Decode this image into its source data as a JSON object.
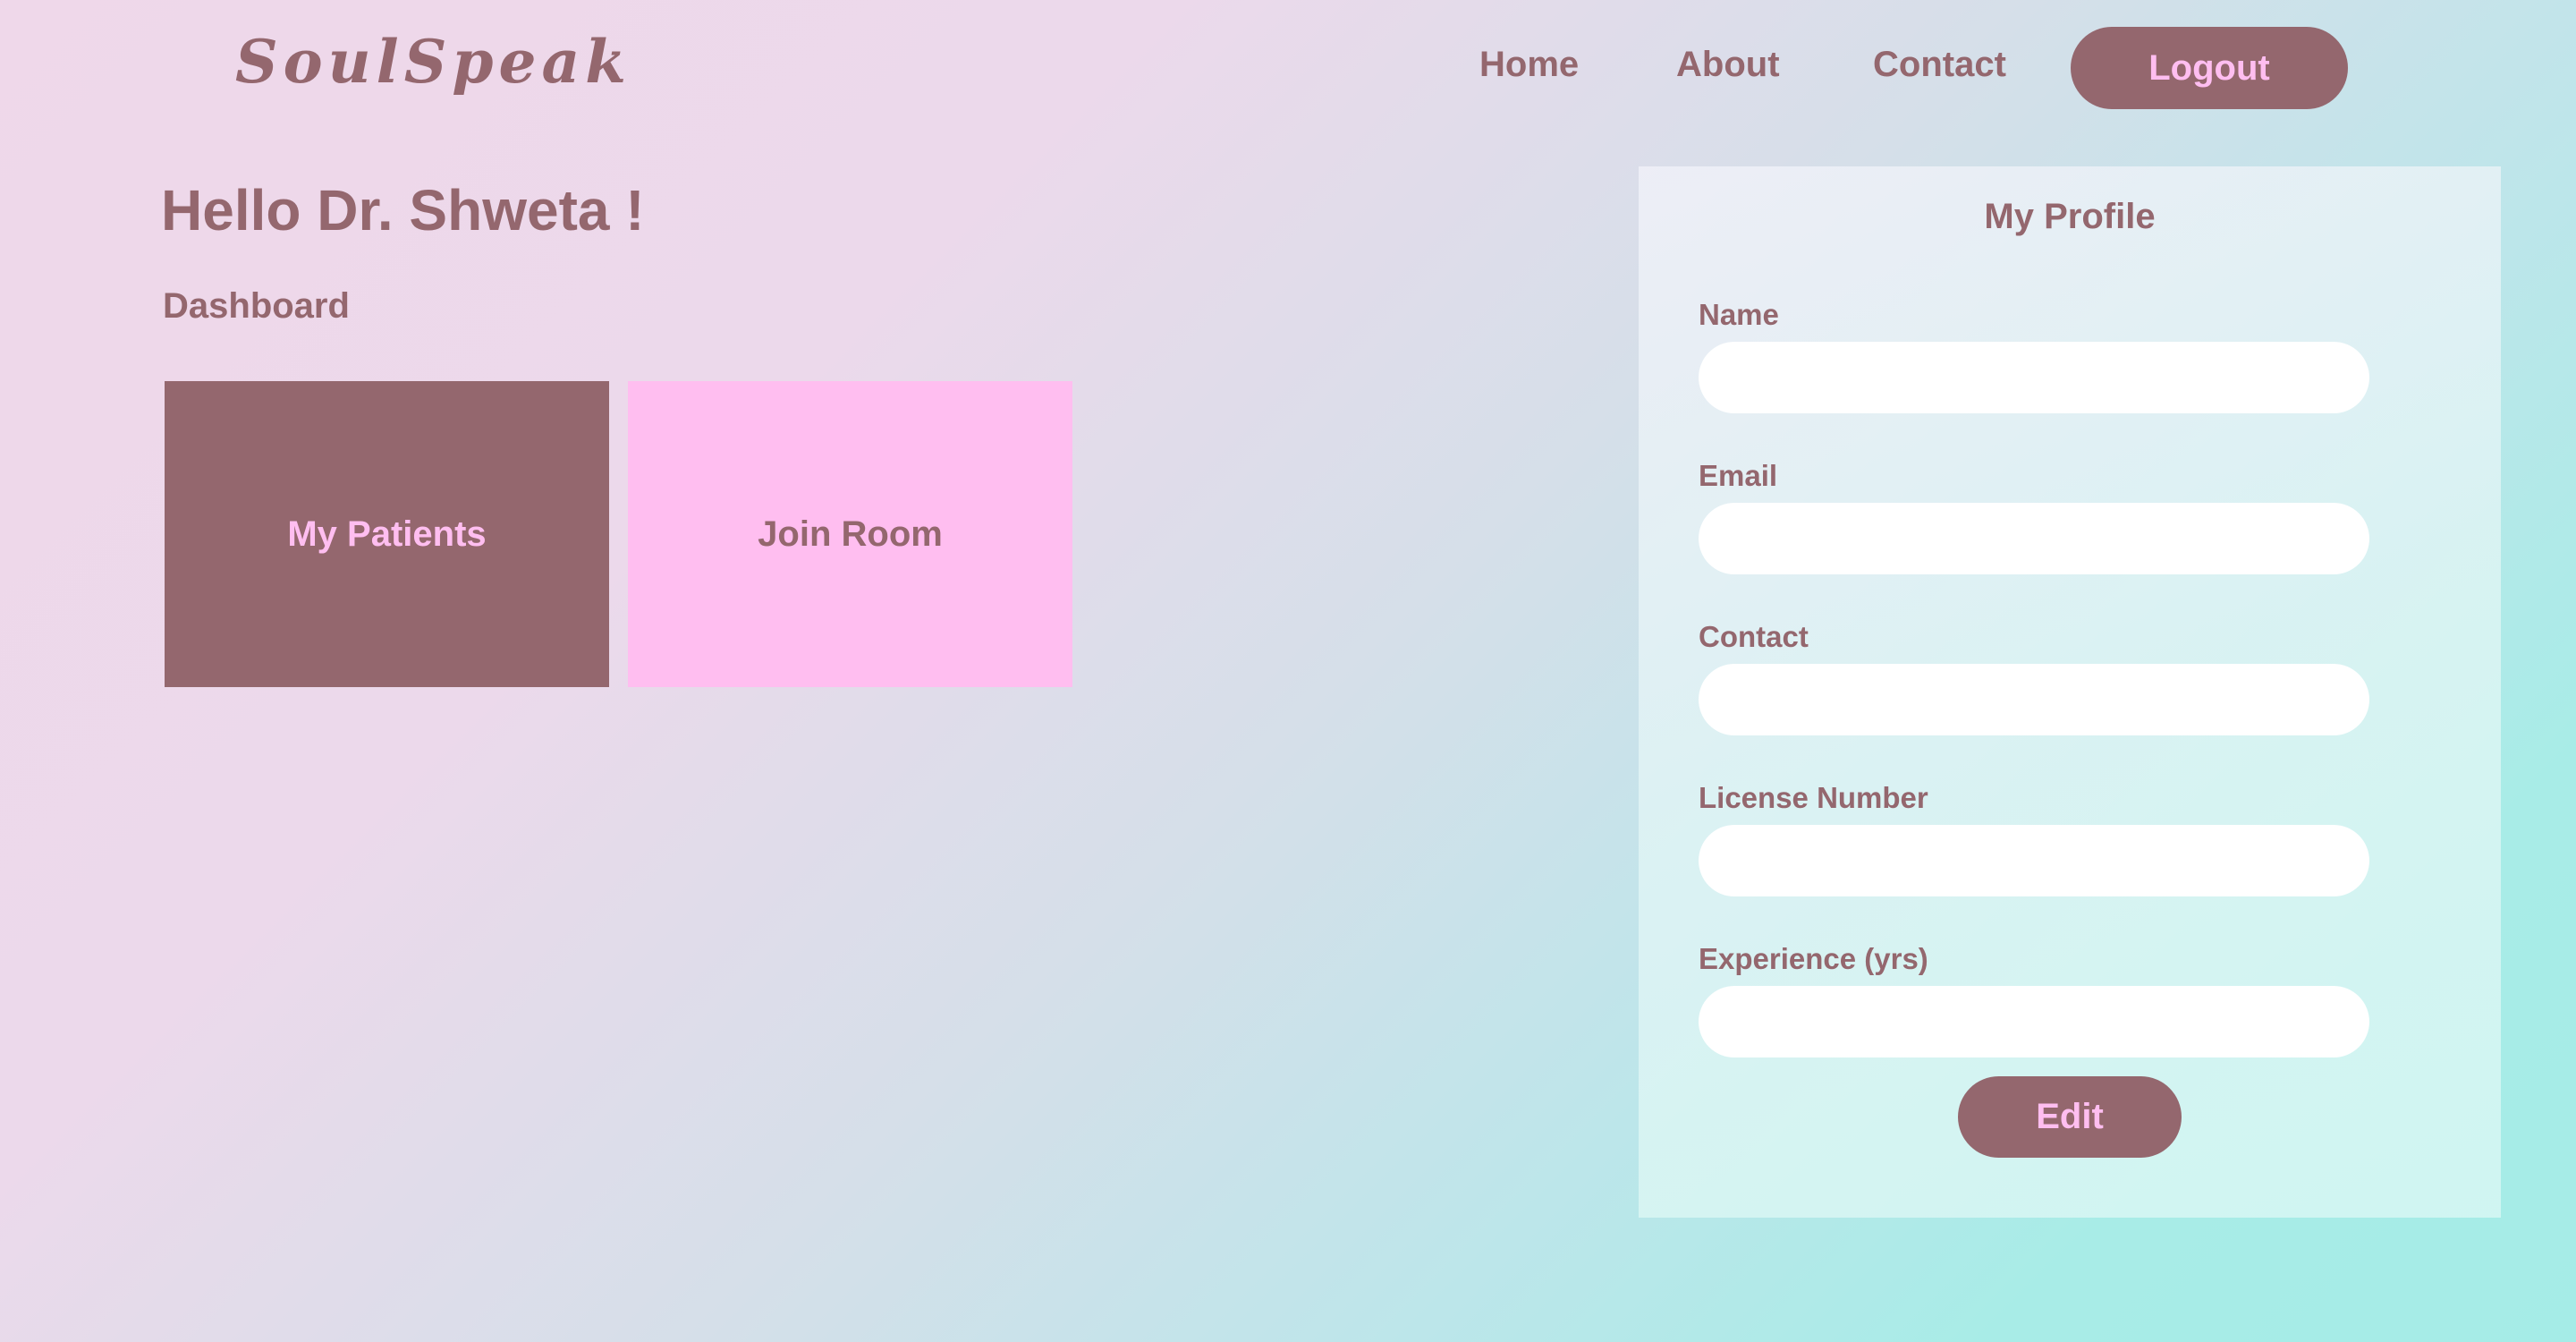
{
  "brand": {
    "name": "SoulSpeak"
  },
  "nav": {
    "links": [
      {
        "label": "Home"
      },
      {
        "label": "About"
      },
      {
        "label": "Contact"
      }
    ],
    "logout_label": "Logout"
  },
  "main": {
    "greeting": "Hello Dr. Shweta !",
    "section_title": "Dashboard",
    "tiles": [
      {
        "label": "My Patients"
      },
      {
        "label": "Join Room"
      }
    ]
  },
  "profile": {
    "title": "My Profile",
    "fields": [
      {
        "label": "Name",
        "value": "",
        "placeholder": ""
      },
      {
        "label": "Email",
        "value": "",
        "placeholder": ""
      },
      {
        "label": "Contact",
        "value": "",
        "placeholder": ""
      },
      {
        "label": "License Number",
        "value": "",
        "placeholder": ""
      },
      {
        "label": "Experience (yrs)",
        "value": "",
        "placeholder": ""
      }
    ],
    "edit_label": "Edit"
  },
  "colors": {
    "primary": "#94676e",
    "accent_pink": "#ffbef0",
    "input_bg": "#ffffff"
  }
}
